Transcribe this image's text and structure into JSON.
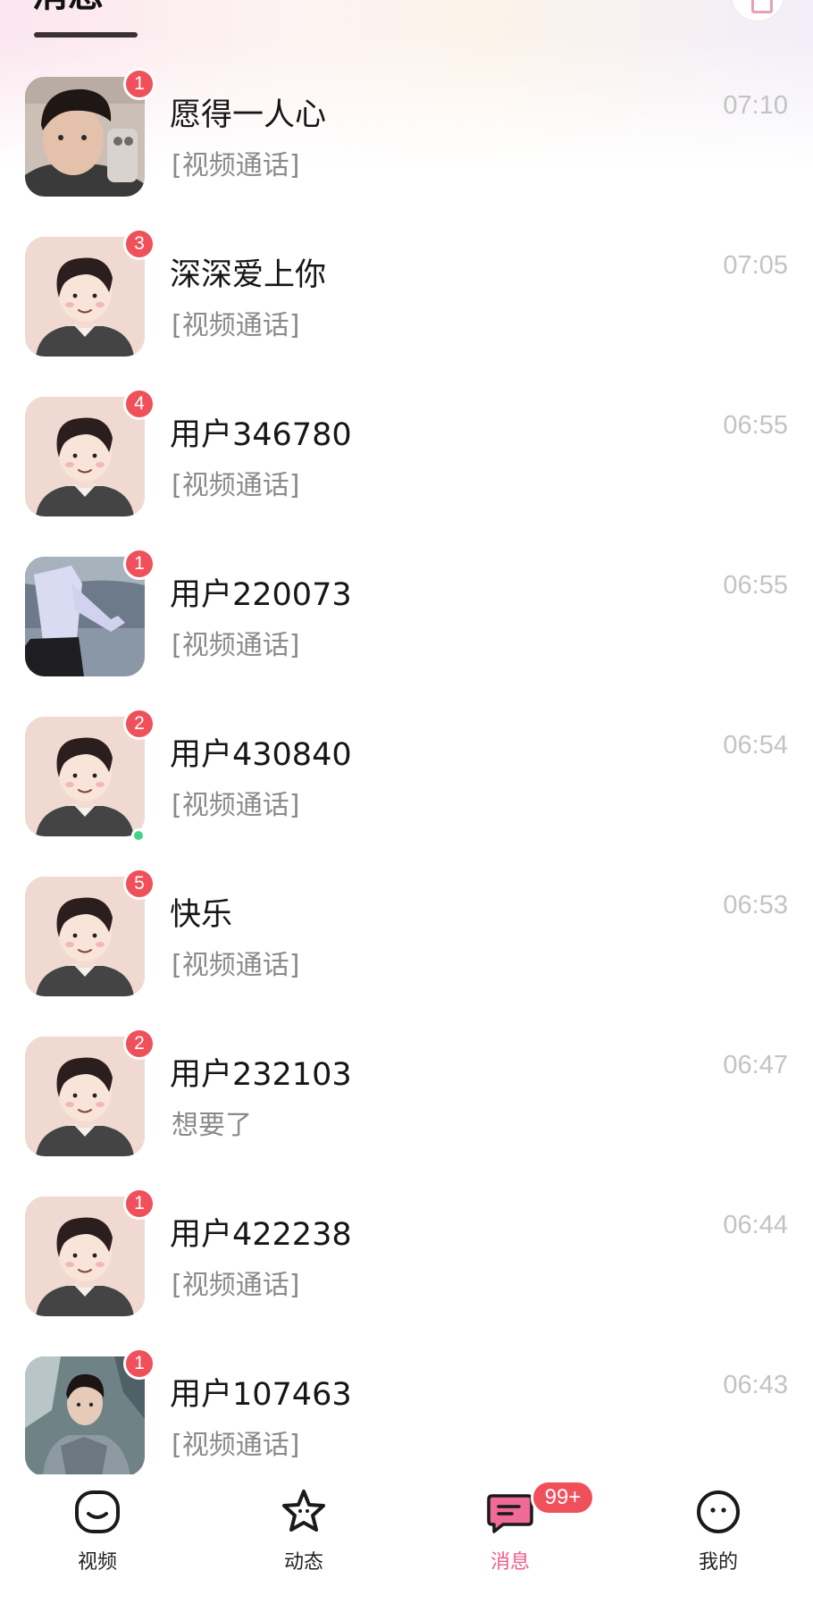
{
  "header": {
    "title": "消息"
  },
  "conversations": [
    {
      "name": "愿得一人心",
      "preview": "[视频通话]",
      "time": "07:10",
      "unread": "1",
      "avatar": "photo-selfie",
      "online": false
    },
    {
      "name": "深深爱上你",
      "preview": "[视频通话]",
      "time": "07:05",
      "unread": "3",
      "avatar": "default-cartoon",
      "online": false
    },
    {
      "name": "用户346780",
      "preview": "[视频通话]",
      "time": "06:55",
      "unread": "4",
      "avatar": "default-cartoon",
      "online": false
    },
    {
      "name": "用户220073",
      "preview": "[视频通话]",
      "time": "06:55",
      "unread": "1",
      "avatar": "photo-lake",
      "online": false
    },
    {
      "name": "用户430840",
      "preview": "[视频通话]",
      "time": "06:54",
      "unread": "2",
      "avatar": "default-cartoon",
      "online": true
    },
    {
      "name": "快乐",
      "preview": "[视频通话]",
      "time": "06:53",
      "unread": "5",
      "avatar": "default-cartoon",
      "online": false
    },
    {
      "name": "用户232103",
      "preview": "想要了",
      "time": "06:47",
      "unread": "2",
      "avatar": "default-cartoon",
      "online": false
    },
    {
      "name": "用户422238",
      "preview": "[视频通话]",
      "time": "06:44",
      "unread": "1",
      "avatar": "default-cartoon",
      "online": false
    },
    {
      "name": "用户107463",
      "preview": "[视频通话]",
      "time": "06:43",
      "unread": "1",
      "avatar": "photo-armor",
      "online": false
    }
  ],
  "tabbar": {
    "tabs": [
      {
        "label": "视频",
        "icon": "video-smile-icon"
      },
      {
        "label": "动态",
        "icon": "star-icon"
      },
      {
        "label": "消息",
        "icon": "chat-bubble-icon",
        "badge": "99+"
      },
      {
        "label": "我的",
        "icon": "profile-face-icon"
      }
    ]
  },
  "colors": {
    "badge": "#f0505a",
    "accent": "#ee5c8c",
    "online": "#3fd68a",
    "time": "#c3c3c3",
    "preview": "#8a8a8a"
  }
}
